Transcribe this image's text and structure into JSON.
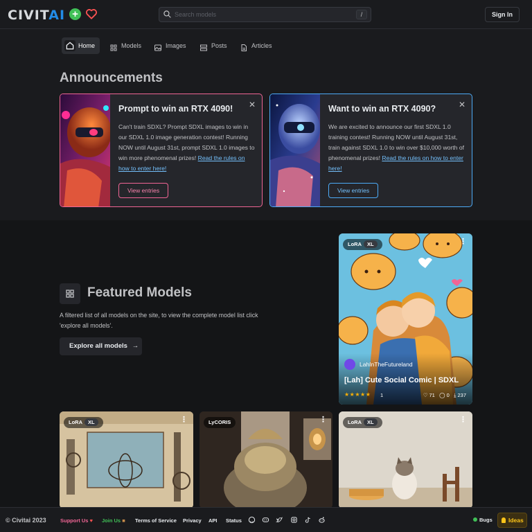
{
  "header": {
    "logo_main": "CIVIT",
    "logo_ai": "AI",
    "search_placeholder": "Search models",
    "search_shortcut": "/",
    "signin_label": "Sign In"
  },
  "nav": [
    {
      "label": "Home",
      "icon": "home-icon",
      "active": true
    },
    {
      "label": "Models",
      "icon": "grid-icon"
    },
    {
      "label": "Images",
      "icon": "image-icon"
    },
    {
      "label": "Posts",
      "icon": "layout-icon"
    },
    {
      "label": "Articles",
      "icon": "file-text-icon"
    }
  ],
  "announcements": {
    "title": "Announcements",
    "cards": [
      {
        "title": "Prompt to win an RTX 4090!",
        "body": "Can't train SDXL? Prompt SDXL images to win in our SDXL 1.0 image generation contest! Running NOW until August 31st, prompt SDXL 1.0 images to win more phenomenal prizes! ",
        "link": "Read the rules on how to enter here!",
        "button": "View entries",
        "accent": "#f06595"
      },
      {
        "title": "Want to win an RTX 4090?",
        "body": "We are excited to announce our first SDXL 1.0 training contest! Running NOW until August 31st, train against SDXL 1.0 to win over $10,000 worth of phenomenal prizes! ",
        "link": "Read the rules on how to enter here!",
        "button": "View entries",
        "accent": "#4dabf7"
      }
    ]
  },
  "featured": {
    "title": "Featured Models",
    "description": "A filtered list of all models on the site, to view the complete model list click 'explore all models'.",
    "explore_label": "Explore all models",
    "explore_arrow": "→",
    "hero_card": {
      "badge_type": "LoRA",
      "badge_base": "XL",
      "creator": "LahInTheFutureland",
      "name": "[Lah] Cute Social Comic | SDXL",
      "stars": "★★★★★",
      "rating_count": "1",
      "likes": "71",
      "comments": "0",
      "downloads": "237"
    },
    "cards": [
      {
        "badge_type": "LoRA",
        "badge_base": "XL"
      },
      {
        "badge_type": "LyCORIS",
        "badge_base": ""
      },
      {
        "badge_type": "LoRA",
        "badge_base": "XL"
      }
    ]
  },
  "footer": {
    "copyright": "© Civitai 2023",
    "support_us": "Support Us",
    "join_us": "Join Us",
    "terms": "Terms of Service",
    "privacy": "Privacy",
    "api": "API",
    "status": "Status",
    "bugs": "Bugs",
    "ideas": "Ideas",
    "support_color": "#f06595",
    "join_color": "#40c057"
  }
}
